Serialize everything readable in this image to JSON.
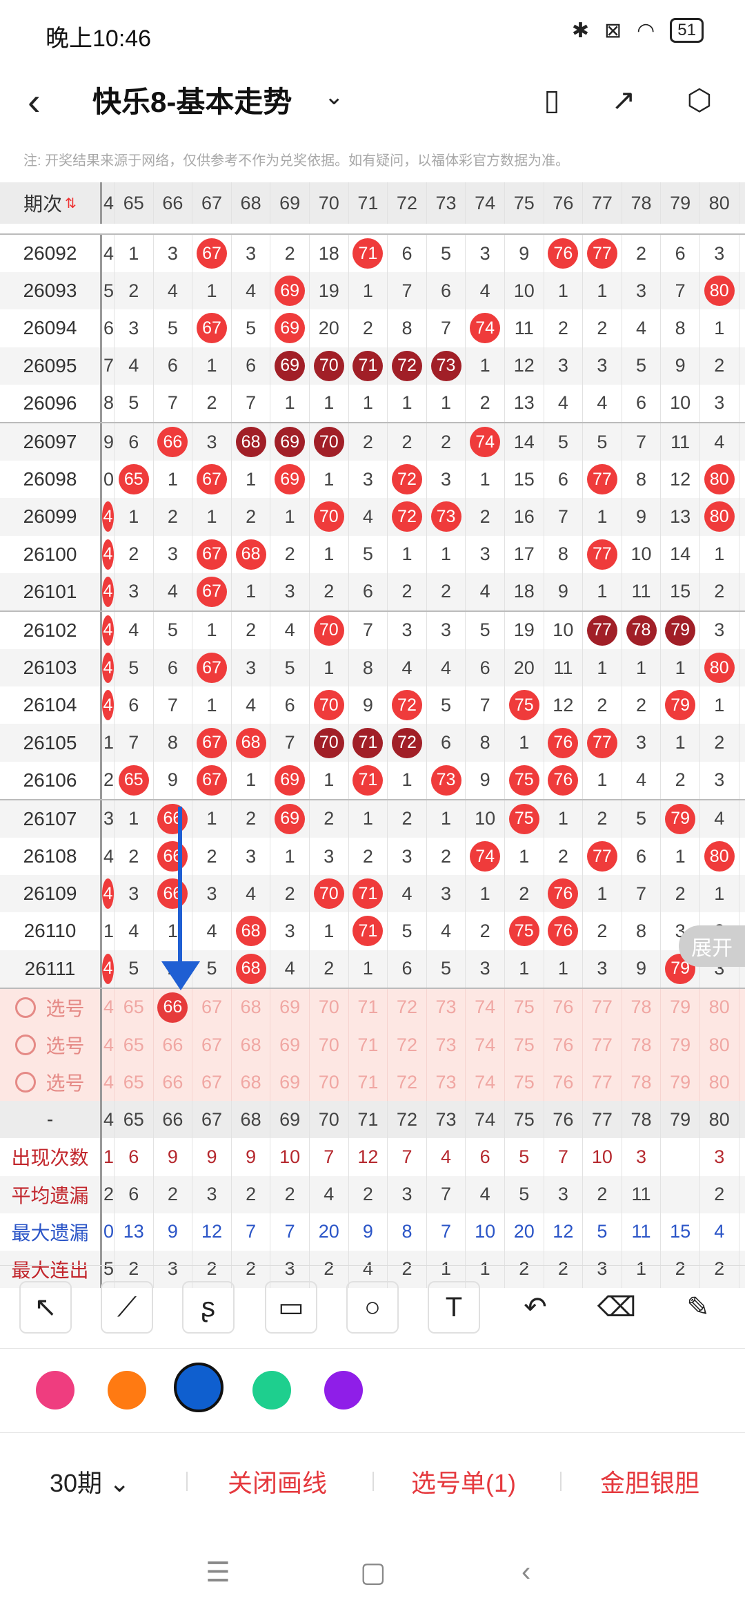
{
  "status": {
    "time": "晚上10:46",
    "battery": "51"
  },
  "header": {
    "title": "快乐8-基本走势"
  },
  "note": "注: 开奖结果来源于网络，仅供参考不作为兑奖依据。如有疑问，以福体彩官方数据为准。",
  "columns": [
    "4",
    "65",
    "66",
    "67",
    "68",
    "69",
    "70",
    "71",
    "72",
    "73",
    "74",
    "75",
    "76",
    "77",
    "78",
    "79",
    "80"
  ],
  "head_label": "期次",
  "rows": [
    {
      "issue": "26092",
      "cells": [
        "4",
        "1",
        "3",
        {
          "b": "67",
          "t": "red"
        },
        "3",
        "2",
        "18",
        {
          "b": "71",
          "t": "red"
        },
        "6",
        "5",
        "3",
        "9",
        {
          "b": "76",
          "t": "red"
        },
        {
          "b": "77",
          "t": "red"
        },
        "2",
        "6",
        "3"
      ]
    },
    {
      "issue": "26093",
      "cells": [
        "5",
        "2",
        "4",
        "1",
        "4",
        {
          "b": "69",
          "t": "red"
        },
        "19",
        "1",
        "7",
        "6",
        "4",
        "10",
        "1",
        "1",
        "3",
        "7",
        {
          "b": "80",
          "t": "red"
        }
      ]
    },
    {
      "issue": "26094",
      "cells": [
        "6",
        "3",
        "5",
        {
          "b": "67",
          "t": "red"
        },
        "5",
        {
          "b": "69",
          "t": "red"
        },
        "20",
        "2",
        "8",
        "7",
        {
          "b": "74",
          "t": "red"
        },
        "11",
        "2",
        "2",
        "4",
        "8",
        "1"
      ]
    },
    {
      "issue": "26095",
      "cells": [
        "7",
        "4",
        "6",
        "1",
        "6",
        {
          "b": "69",
          "t": "dark"
        },
        {
          "b": "70",
          "t": "dark"
        },
        {
          "b": "71",
          "t": "dark"
        },
        {
          "b": "72",
          "t": "dark"
        },
        {
          "b": "73",
          "t": "dark"
        },
        "1",
        "12",
        "3",
        "3",
        "5",
        "9",
        "2"
      ]
    },
    {
      "issue": "26096",
      "cells": [
        "8",
        "5",
        "7",
        "2",
        "7",
        "1",
        "1",
        "1",
        "1",
        "1",
        "2",
        "13",
        "4",
        "4",
        "6",
        "10",
        "3"
      ]
    },
    {
      "issue": "26097",
      "cells": [
        "9",
        "6",
        {
          "b": "66",
          "t": "red"
        },
        "3",
        {
          "b": "68",
          "t": "dark"
        },
        {
          "b": "69",
          "t": "dark"
        },
        {
          "b": "70",
          "t": "dark"
        },
        "2",
        "2",
        "2",
        {
          "b": "74",
          "t": "red"
        },
        "14",
        "5",
        "5",
        "7",
        "11",
        "4"
      ]
    },
    {
      "issue": "26098",
      "cells": [
        "0",
        {
          "b": "65",
          "t": "red"
        },
        "1",
        {
          "b": "67",
          "t": "red"
        },
        "1",
        {
          "b": "69",
          "t": "red"
        },
        "1",
        "3",
        {
          "b": "72",
          "t": "red"
        },
        "3",
        "1",
        "15",
        "6",
        {
          "b": "77",
          "t": "red"
        },
        "8",
        "12",
        {
          "b": "80",
          "t": "red"
        }
      ]
    },
    {
      "issue": "26099",
      "cells": [
        {
          "b": "4",
          "t": "red"
        },
        "1",
        "2",
        "1",
        "2",
        "1",
        {
          "b": "70",
          "t": "red"
        },
        "4",
        {
          "b": "72",
          "t": "red"
        },
        {
          "b": "73",
          "t": "red"
        },
        "2",
        "16",
        "7",
        "1",
        "9",
        "13",
        {
          "b": "80",
          "t": "red"
        }
      ]
    },
    {
      "issue": "26100",
      "cells": [
        {
          "b": "4",
          "t": "red"
        },
        "2",
        "3",
        {
          "b": "67",
          "t": "red"
        },
        {
          "b": "68",
          "t": "red"
        },
        "2",
        "1",
        "5",
        "1",
        "1",
        "3",
        "17",
        "8",
        {
          "b": "77",
          "t": "red"
        },
        "10",
        "14",
        "1"
      ]
    },
    {
      "issue": "26101",
      "cells": [
        {
          "b": "4",
          "t": "red"
        },
        "3",
        "4",
        {
          "b": "67",
          "t": "red"
        },
        "1",
        "3",
        "2",
        "6",
        "2",
        "2",
        "4",
        "18",
        "9",
        "1",
        "11",
        "15",
        "2"
      ]
    },
    {
      "issue": "26102",
      "cells": [
        {
          "b": "4",
          "t": "red"
        },
        "4",
        "5",
        "1",
        "2",
        "4",
        {
          "b": "70",
          "t": "red"
        },
        "7",
        "3",
        "3",
        "5",
        "19",
        "10",
        {
          "b": "77",
          "t": "dark"
        },
        {
          "b": "78",
          "t": "dark"
        },
        {
          "b": "79",
          "t": "dark"
        },
        "3"
      ]
    },
    {
      "issue": "26103",
      "cells": [
        {
          "b": "4",
          "t": "red"
        },
        "5",
        "6",
        {
          "b": "67",
          "t": "red"
        },
        "3",
        "5",
        "1",
        "8",
        "4",
        "4",
        "6",
        "20",
        "11",
        "1",
        "1",
        "1",
        {
          "b": "80",
          "t": "red"
        }
      ]
    },
    {
      "issue": "26104",
      "cells": [
        {
          "b": "4",
          "t": "red"
        },
        "6",
        "7",
        "1",
        "4",
        "6",
        {
          "b": "70",
          "t": "red"
        },
        "9",
        {
          "b": "72",
          "t": "red"
        },
        "5",
        "7",
        {
          "b": "75",
          "t": "red"
        },
        "12",
        "2",
        "2",
        {
          "b": "79",
          "t": "red"
        },
        "1"
      ]
    },
    {
      "issue": "26105",
      "cells": [
        "1",
        "7",
        "8",
        {
          "b": "67",
          "t": "red"
        },
        {
          "b": "68",
          "t": "red"
        },
        "7",
        {
          "b": "70",
          "t": "dark"
        },
        {
          "b": "71",
          "t": "dark"
        },
        {
          "b": "72",
          "t": "dark"
        },
        "6",
        "8",
        "1",
        {
          "b": "76",
          "t": "red"
        },
        {
          "b": "77",
          "t": "red"
        },
        "3",
        "1",
        "2"
      ]
    },
    {
      "issue": "26106",
      "cells": [
        "2",
        {
          "b": "65",
          "t": "red"
        },
        "9",
        {
          "b": "67",
          "t": "red"
        },
        "1",
        {
          "b": "69",
          "t": "red"
        },
        "1",
        {
          "b": "71",
          "t": "red"
        },
        "1",
        {
          "b": "73",
          "t": "red"
        },
        "9",
        {
          "b": "75",
          "t": "red"
        },
        {
          "b": "76",
          "t": "red"
        },
        "1",
        "4",
        "2",
        "3"
      ]
    },
    {
      "issue": "26107",
      "cells": [
        "3",
        "1",
        {
          "b": "66",
          "t": "red"
        },
        "1",
        "2",
        {
          "b": "69",
          "t": "red"
        },
        "2",
        "1",
        "2",
        "1",
        "10",
        {
          "b": "75",
          "t": "red"
        },
        "1",
        "2",
        "5",
        {
          "b": "79",
          "t": "red"
        },
        "4"
      ]
    },
    {
      "issue": "26108",
      "cells": [
        "4",
        "2",
        {
          "b": "66",
          "t": "red"
        },
        "2",
        "3",
        "1",
        "3",
        "2",
        "3",
        "2",
        {
          "b": "74",
          "t": "red"
        },
        "1",
        "2",
        {
          "b": "77",
          "t": "red"
        },
        "6",
        "1",
        {
          "b": "80",
          "t": "red"
        }
      ]
    },
    {
      "issue": "26109",
      "cells": [
        {
          "b": "4",
          "t": "red"
        },
        "3",
        {
          "b": "66",
          "t": "red"
        },
        "3",
        "4",
        "2",
        {
          "b": "70",
          "t": "red"
        },
        {
          "b": "71",
          "t": "red"
        },
        "4",
        "3",
        "1",
        "2",
        {
          "b": "76",
          "t": "red"
        },
        "1",
        "7",
        "2",
        "1"
      ]
    },
    {
      "issue": "26110",
      "cells": [
        "1",
        "4",
        "1",
        "4",
        {
          "b": "68",
          "t": "red"
        },
        "3",
        "1",
        {
          "b": "71",
          "t": "red"
        },
        "5",
        "4",
        "2",
        {
          "b": "75",
          "t": "red"
        },
        {
          "b": "76",
          "t": "red"
        },
        "2",
        "8",
        "3",
        "2"
      ]
    },
    {
      "issue": "26111",
      "cells": [
        {
          "b": "4",
          "t": "red"
        },
        "5",
        "2",
        "5",
        {
          "b": "68",
          "t": "red"
        },
        "4",
        "2",
        "1",
        "6",
        "5",
        "3",
        "1",
        "1",
        "3",
        "9",
        {
          "b": "79",
          "t": "red"
        },
        "3"
      ]
    }
  ],
  "pick_label": "选号",
  "pick_selected_col": 2,
  "footer_label": "-",
  "stats": [
    {
      "label": "出现次数",
      "cls": "red-row",
      "values": [
        "1",
        "6",
        "9",
        "9",
        "9",
        "10",
        "7",
        "12",
        "7",
        "4",
        "6",
        "5",
        "7",
        "10",
        "3",
        "",
        "3"
      ]
    },
    {
      "label": "平均遗漏",
      "cls": "",
      "values": [
        "2",
        "6",
        "2",
        "3",
        "2",
        "2",
        "4",
        "2",
        "3",
        "7",
        "4",
        "5",
        "3",
        "2",
        "11",
        "",
        "2"
      ]
    },
    {
      "label": "最大遗漏",
      "cls": "blue-row",
      "values": [
        "0",
        "13",
        "9",
        "12",
        "7",
        "7",
        "20",
        "9",
        "8",
        "7",
        "10",
        "20",
        "12",
        "5",
        "11",
        "15",
        "4"
      ]
    },
    {
      "label": "最大连出",
      "cls": "",
      "values": [
        "5",
        "2",
        "3",
        "2",
        "2",
        "3",
        "2",
        "4",
        "2",
        "1",
        "1",
        "2",
        "2",
        "3",
        "1",
        "2",
        "2"
      ]
    }
  ],
  "expand_label": "展开",
  "colors": {
    "pink": "#ef3d7f",
    "orange": "#ff7a12",
    "blue": "#0f5fcf",
    "green": "#1ecf8e",
    "purple": "#8f1ee8",
    "accent": "#e5393e"
  },
  "bottom": {
    "period": "30期",
    "close_lines": "关闭画线",
    "pick_list": "选号单(1)",
    "gold_silver": "金胆银胆"
  }
}
